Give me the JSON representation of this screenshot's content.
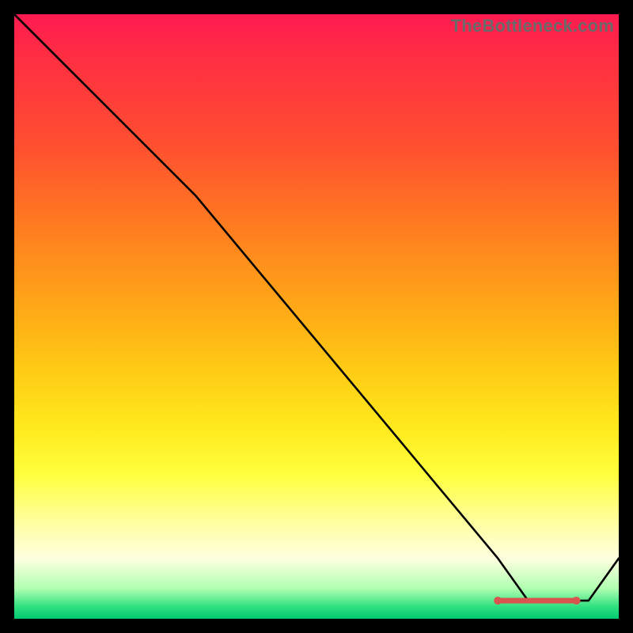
{
  "watermark": "TheBottleneck.com",
  "chart_data": {
    "type": "line",
    "title": "",
    "xlabel": "",
    "ylabel": "",
    "xlim": [
      0,
      100
    ],
    "ylim": [
      0,
      100
    ],
    "x": [
      0,
      10,
      20,
      30,
      40,
      50,
      60,
      70,
      80,
      85,
      90,
      95,
      100
    ],
    "values": [
      100,
      90,
      80,
      70,
      58,
      46,
      34,
      22,
      10,
      3,
      3,
      3,
      10
    ],
    "marker_range": {
      "x0": 80,
      "x1": 93,
      "y": 3
    },
    "colors": {
      "line": "#000000",
      "marker": "#d9534f",
      "gradient_top": "#ff1a50",
      "gradient_bottom": "#00c870"
    }
  }
}
